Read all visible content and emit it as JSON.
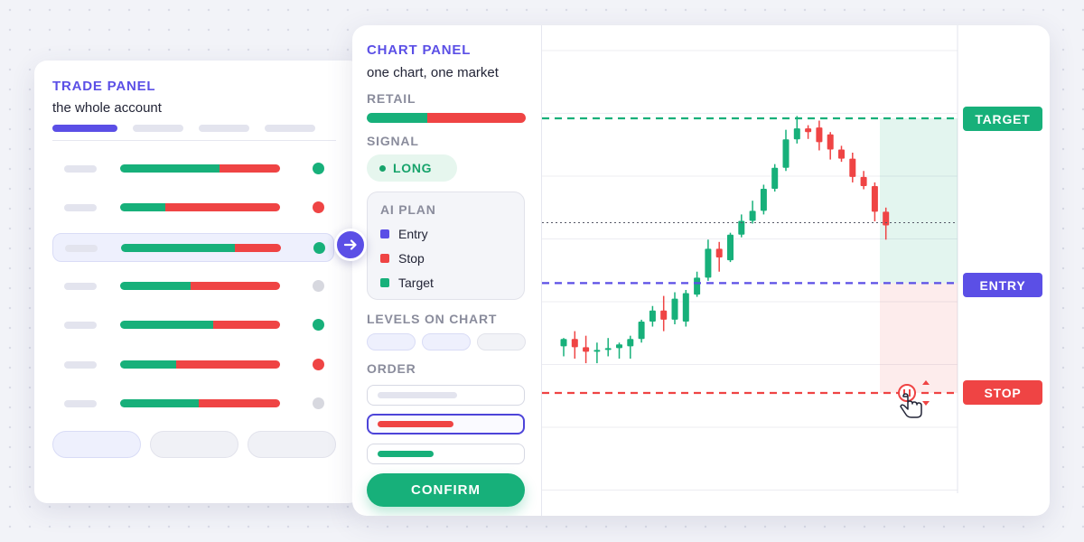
{
  "trade_panel": {
    "title": "TRADE PANEL",
    "subtitle": "the whole account",
    "rows": [
      {
        "green": 0.62,
        "status_color": "#17b07a",
        "selected": false
      },
      {
        "green": 0.28,
        "status_color": "#ef4444",
        "selected": false
      },
      {
        "green": 0.71,
        "status_color": "#17b07a",
        "selected": true
      },
      {
        "green": 0.44,
        "status_color": "#d7d8df",
        "selected": false
      },
      {
        "green": 0.58,
        "status_color": "#17b07a",
        "selected": false
      },
      {
        "green": 0.35,
        "status_color": "#ef4444",
        "selected": false
      },
      {
        "green": 0.49,
        "status_color": "#d7d8df",
        "selected": false
      }
    ],
    "arrow_icon": "arrow-right-icon"
  },
  "chart_panel": {
    "title": "CHART PANEL",
    "subtitle": "one chart, one market",
    "retail_label": "RETAIL",
    "retail_long_share": 0.38,
    "signal_label": "SIGNAL",
    "signal_value": "LONG",
    "ai_plan": {
      "title": "AI PLAN",
      "items": [
        {
          "label": "Entry",
          "color": "#5b4fe6"
        },
        {
          "label": "Stop",
          "color": "#ef4444"
        },
        {
          "label": "Target",
          "color": "#17b07a"
        }
      ]
    },
    "levels_label": "LEVELS ON CHART",
    "order_label": "ORDER",
    "confirm_label": "CONFIRM"
  },
  "colors": {
    "accent": "#5b4fe6",
    "green": "#17b07a",
    "red": "#ef4444",
    "muted": "#8a8c9c"
  },
  "chart_data": {
    "type": "candlestick",
    "levels": {
      "target": 100,
      "entry": 64,
      "stop": 40
    },
    "level_labels": {
      "target": "TARGET",
      "entry": "ENTRY",
      "stop": "STOP"
    },
    "candles": [
      {
        "o": 50.2,
        "h": 52,
        "l": 48,
        "c": 51.8
      },
      {
        "o": 51.8,
        "h": 53.5,
        "l": 47.5,
        "c": 50
      },
      {
        "o": 50,
        "h": 52.5,
        "l": 46.5,
        "c": 49
      },
      {
        "o": 49,
        "h": 51,
        "l": 46.5,
        "c": 49.4
      },
      {
        "o": 49.4,
        "h": 52,
        "l": 48,
        "c": 49.8
      },
      {
        "o": 49.8,
        "h": 51,
        "l": 47.5,
        "c": 50.6
      },
      {
        "o": 50.2,
        "h": 52.5,
        "l": 47.5,
        "c": 51.8
      },
      {
        "o": 51.8,
        "h": 56,
        "l": 51,
        "c": 55.6
      },
      {
        "o": 55.6,
        "h": 59,
        "l": 54.5,
        "c": 58
      },
      {
        "o": 58,
        "h": 61.2,
        "l": 53.5,
        "c": 56
      },
      {
        "o": 56,
        "h": 62,
        "l": 55,
        "c": 60.6
      },
      {
        "o": 55.6,
        "h": 62.5,
        "l": 54.5,
        "c": 61.8
      },
      {
        "o": 61.5,
        "h": 66.5,
        "l": 61,
        "c": 65.2
      },
      {
        "o": 65.2,
        "h": 73.5,
        "l": 64.5,
        "c": 71.5
      },
      {
        "o": 71.5,
        "h": 73,
        "l": 66.5,
        "c": 69.6
      },
      {
        "o": 69,
        "h": 75,
        "l": 68.6,
        "c": 74.6
      },
      {
        "o": 74.6,
        "h": 79,
        "l": 74,
        "c": 77.6
      },
      {
        "o": 77.6,
        "h": 82,
        "l": 77,
        "c": 79.8
      },
      {
        "o": 79.8,
        "h": 85.5,
        "l": 79,
        "c": 84.6
      },
      {
        "o": 84.6,
        "h": 90,
        "l": 84,
        "c": 89.2
      },
      {
        "o": 89.2,
        "h": 97.5,
        "l": 88.5,
        "c": 95.4
      },
      {
        "o": 95.4,
        "h": 100.5,
        "l": 94.5,
        "c": 97.8
      },
      {
        "o": 97.8,
        "h": 98.5,
        "l": 95.5,
        "c": 97
      },
      {
        "o": 98,
        "h": 99.5,
        "l": 93,
        "c": 94.8
      },
      {
        "o": 96.5,
        "h": 97,
        "l": 91,
        "c": 93.2
      },
      {
        "o": 93.2,
        "h": 94,
        "l": 90.5,
        "c": 91.2
      },
      {
        "o": 91.2,
        "h": 92.5,
        "l": 86,
        "c": 87.2
      },
      {
        "o": 87.2,
        "h": 88.5,
        "l": 84.5,
        "c": 85.2
      },
      {
        "o": 85.2,
        "h": 86,
        "l": 77.5,
        "c": 79.6
      },
      {
        "o": 79.6,
        "h": 80.5,
        "l": 73.5,
        "c": 76.6
      }
    ]
  }
}
